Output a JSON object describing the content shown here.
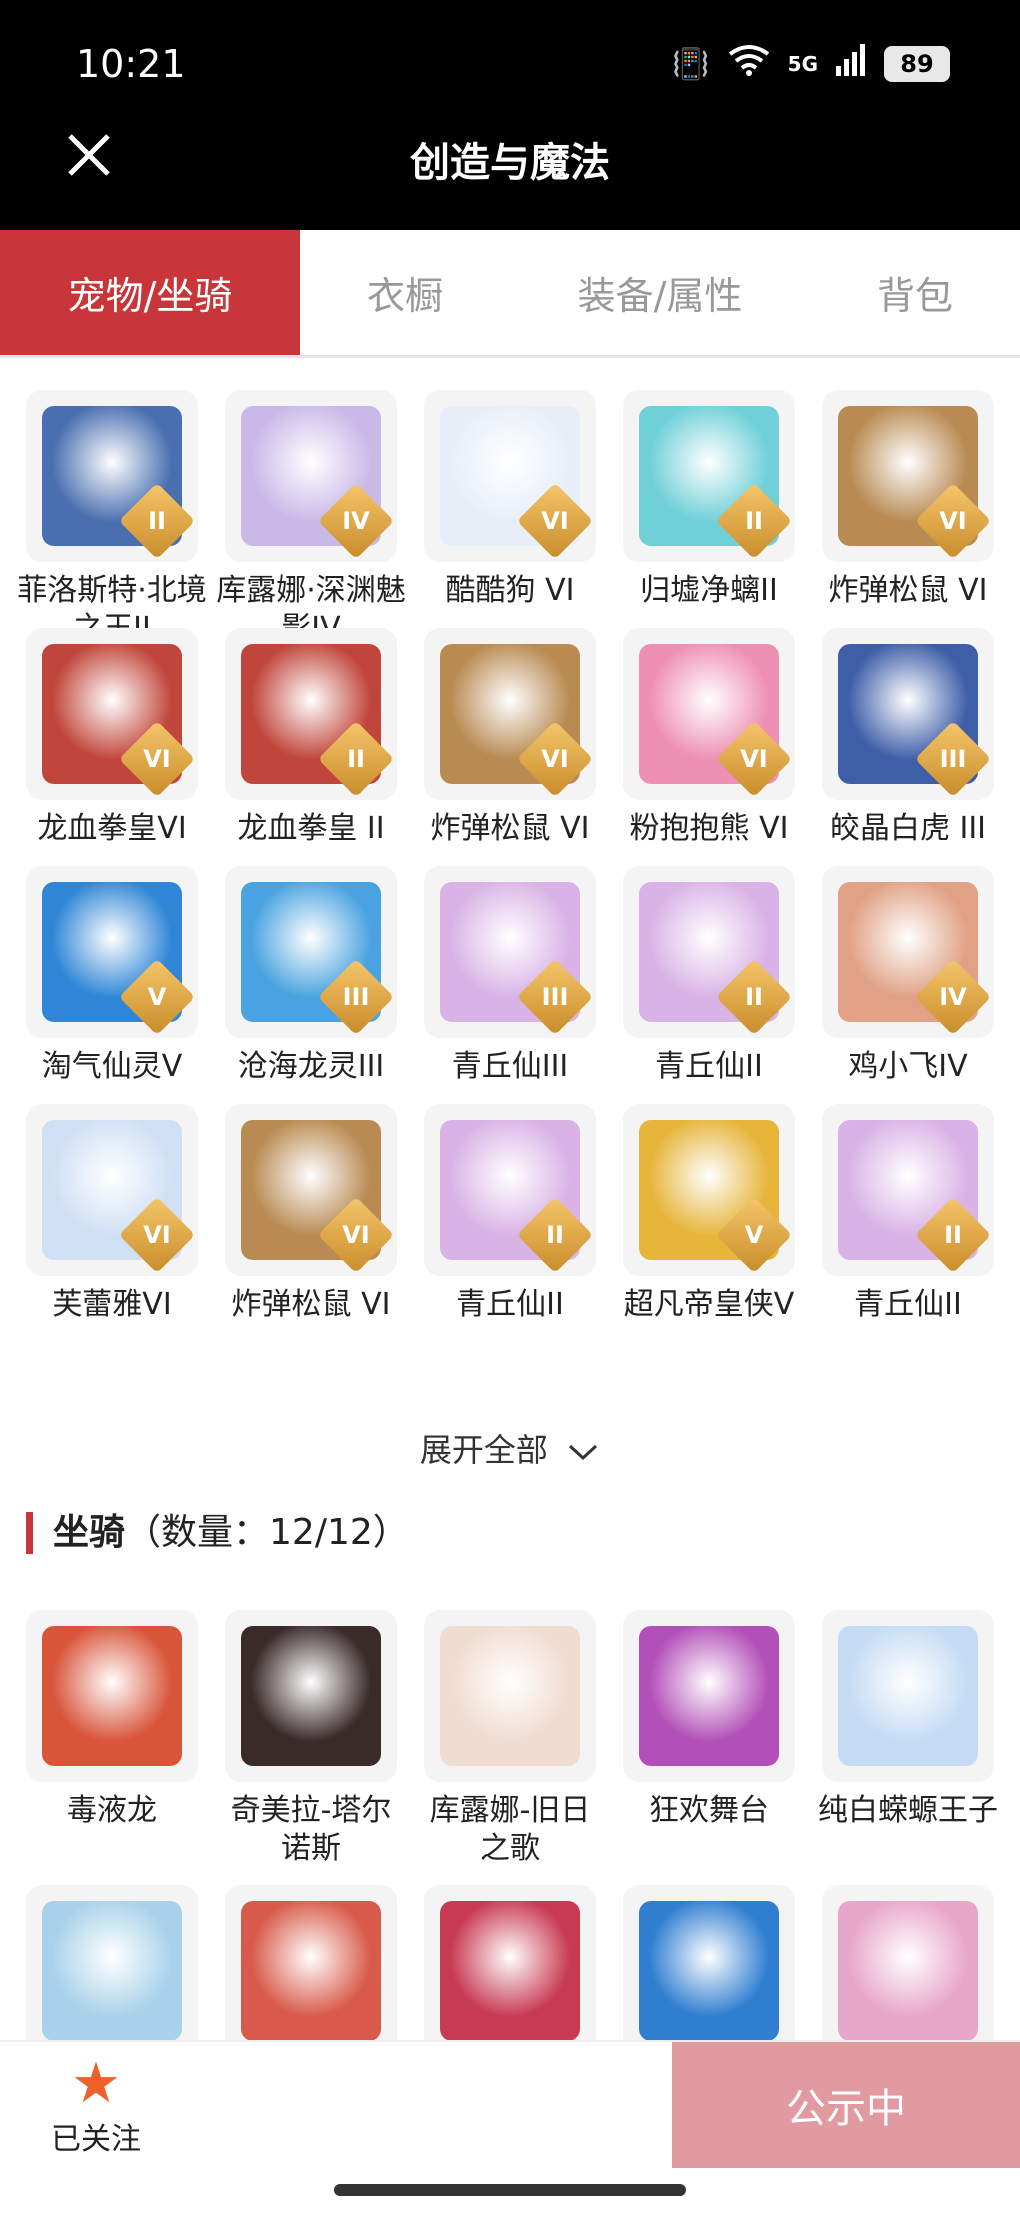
{
  "status": {
    "time": "10:21",
    "network": "5G",
    "battery": "89"
  },
  "header": {
    "title": "创造与魔法"
  },
  "tabs": [
    {
      "label": "宠物/坐骑",
      "active": true
    },
    {
      "label": "衣橱",
      "active": false
    },
    {
      "label": "装备/属性",
      "active": false
    },
    {
      "label": "背包",
      "active": false
    }
  ],
  "pets": [
    {
      "name": "菲洛斯特·北境之王II",
      "grade": "II",
      "color": "#4a6fb0"
    },
    {
      "name": "库露娜·深渊魅影IV",
      "grade": "IV",
      "color": "#c9b9e8"
    },
    {
      "name": "酷酷狗 VI",
      "grade": "VI",
      "color": "#e8eef8"
    },
    {
      "name": "归墟净螭II",
      "grade": "II",
      "color": "#6fd0d8"
    },
    {
      "name": "炸弹松鼠 VI",
      "grade": "VI",
      "color": "#b98a52"
    },
    {
      "name": "龙血拳皇VI",
      "grade": "VI",
      "color": "#c0453a"
    },
    {
      "name": "龙血拳皇 II",
      "grade": "II",
      "color": "#c0453a"
    },
    {
      "name": "炸弹松鼠 VI",
      "grade": "VI",
      "color": "#b98a52"
    },
    {
      "name": "粉抱抱熊 VI",
      "grade": "VI",
      "color": "#ee8fb4"
    },
    {
      "name": "皎晶白虎 III",
      "grade": "III",
      "color": "#3e5ea8"
    },
    {
      "name": "淘气仙灵V",
      "grade": "V",
      "color": "#2f86d6"
    },
    {
      "name": "沧海龙灵III",
      "grade": "III",
      "color": "#4aa3e0"
    },
    {
      "name": "青丘仙III",
      "grade": "III",
      "color": "#d9b3e6"
    },
    {
      "name": "青丘仙II",
      "grade": "II",
      "color": "#d9b3e6"
    },
    {
      "name": "鸡小飞IV",
      "grade": "IV",
      "color": "#e0a184"
    },
    {
      "name": "芙蕾雅VI",
      "grade": "VI",
      "color": "#cfe0f4"
    },
    {
      "name": "炸弹松鼠 VI",
      "grade": "VI",
      "color": "#b98a52"
    },
    {
      "name": "青丘仙II",
      "grade": "II",
      "color": "#d9b3e6"
    },
    {
      "name": "超凡帝皇侠V",
      "grade": "V",
      "color": "#e6b53a"
    },
    {
      "name": "青丘仙II",
      "grade": "II",
      "color": "#d9b3e6"
    }
  ],
  "expand_label": "展开全部",
  "mounts_section": {
    "title": "坐骑",
    "count": "（数量：12/12）"
  },
  "mounts": [
    {
      "name": "毒液龙",
      "color": "#d8553a"
    },
    {
      "name": "奇美拉-塔尔诺斯",
      "color": "#3a2a2a"
    },
    {
      "name": "库露娜-旧日之歌",
      "color": "#f0dcd0"
    },
    {
      "name": "狂欢舞台",
      "color": "#b24fb8"
    },
    {
      "name": "纯白蝾螈王子",
      "color": "#c5dcf4"
    },
    {
      "name": "",
      "color": "#a9d2ea"
    },
    {
      "name": "",
      "color": "#d85a4a"
    },
    {
      "name": "",
      "color": "#c83a52"
    },
    {
      "name": "",
      "color": "#2f7ed0"
    },
    {
      "name": "",
      "color": "#e8a6c8"
    }
  ],
  "bottom": {
    "follow_label": "已关注",
    "publish_label": "公示中"
  }
}
